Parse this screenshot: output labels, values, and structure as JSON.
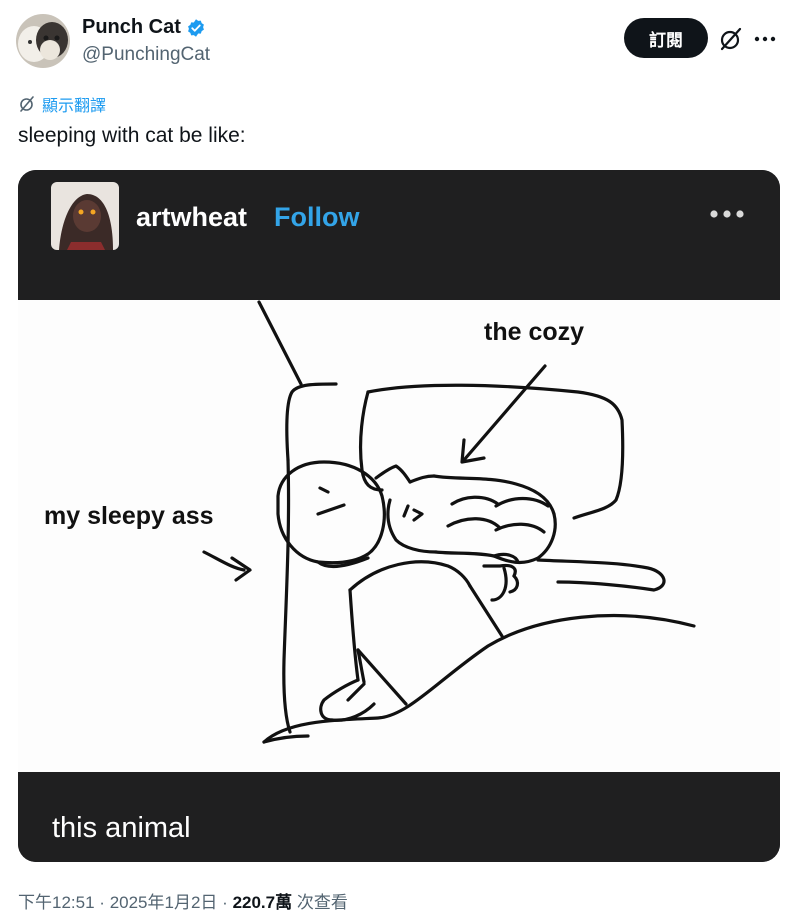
{
  "author": {
    "display_name": "Punch Cat",
    "handle": "@PunchingCat"
  },
  "actions": {
    "subscribe_label": "訂閱",
    "grok_icon": "grok-icon",
    "more_icon": "more-icon"
  },
  "translate": {
    "label": "顯示翻譯"
  },
  "tweet": {
    "text": "sleeping with cat be like:"
  },
  "media": {
    "username": "artwheat",
    "follow_label": "Follow",
    "comic_label_top": "the cozy",
    "comic_label_left": "my sleepy ass",
    "caption": "this animal"
  },
  "meta": {
    "time": "下午12:51",
    "date": "2025年1月2日",
    "views_count": "220.7萬",
    "views_label": "次查看",
    "separator": "·"
  },
  "colors": {
    "accent": "#1d9bf0",
    "dark": "#0f1419",
    "muted": "#536471",
    "media_bg": "#1f1f20",
    "follow_blue": "#33a4e8"
  }
}
